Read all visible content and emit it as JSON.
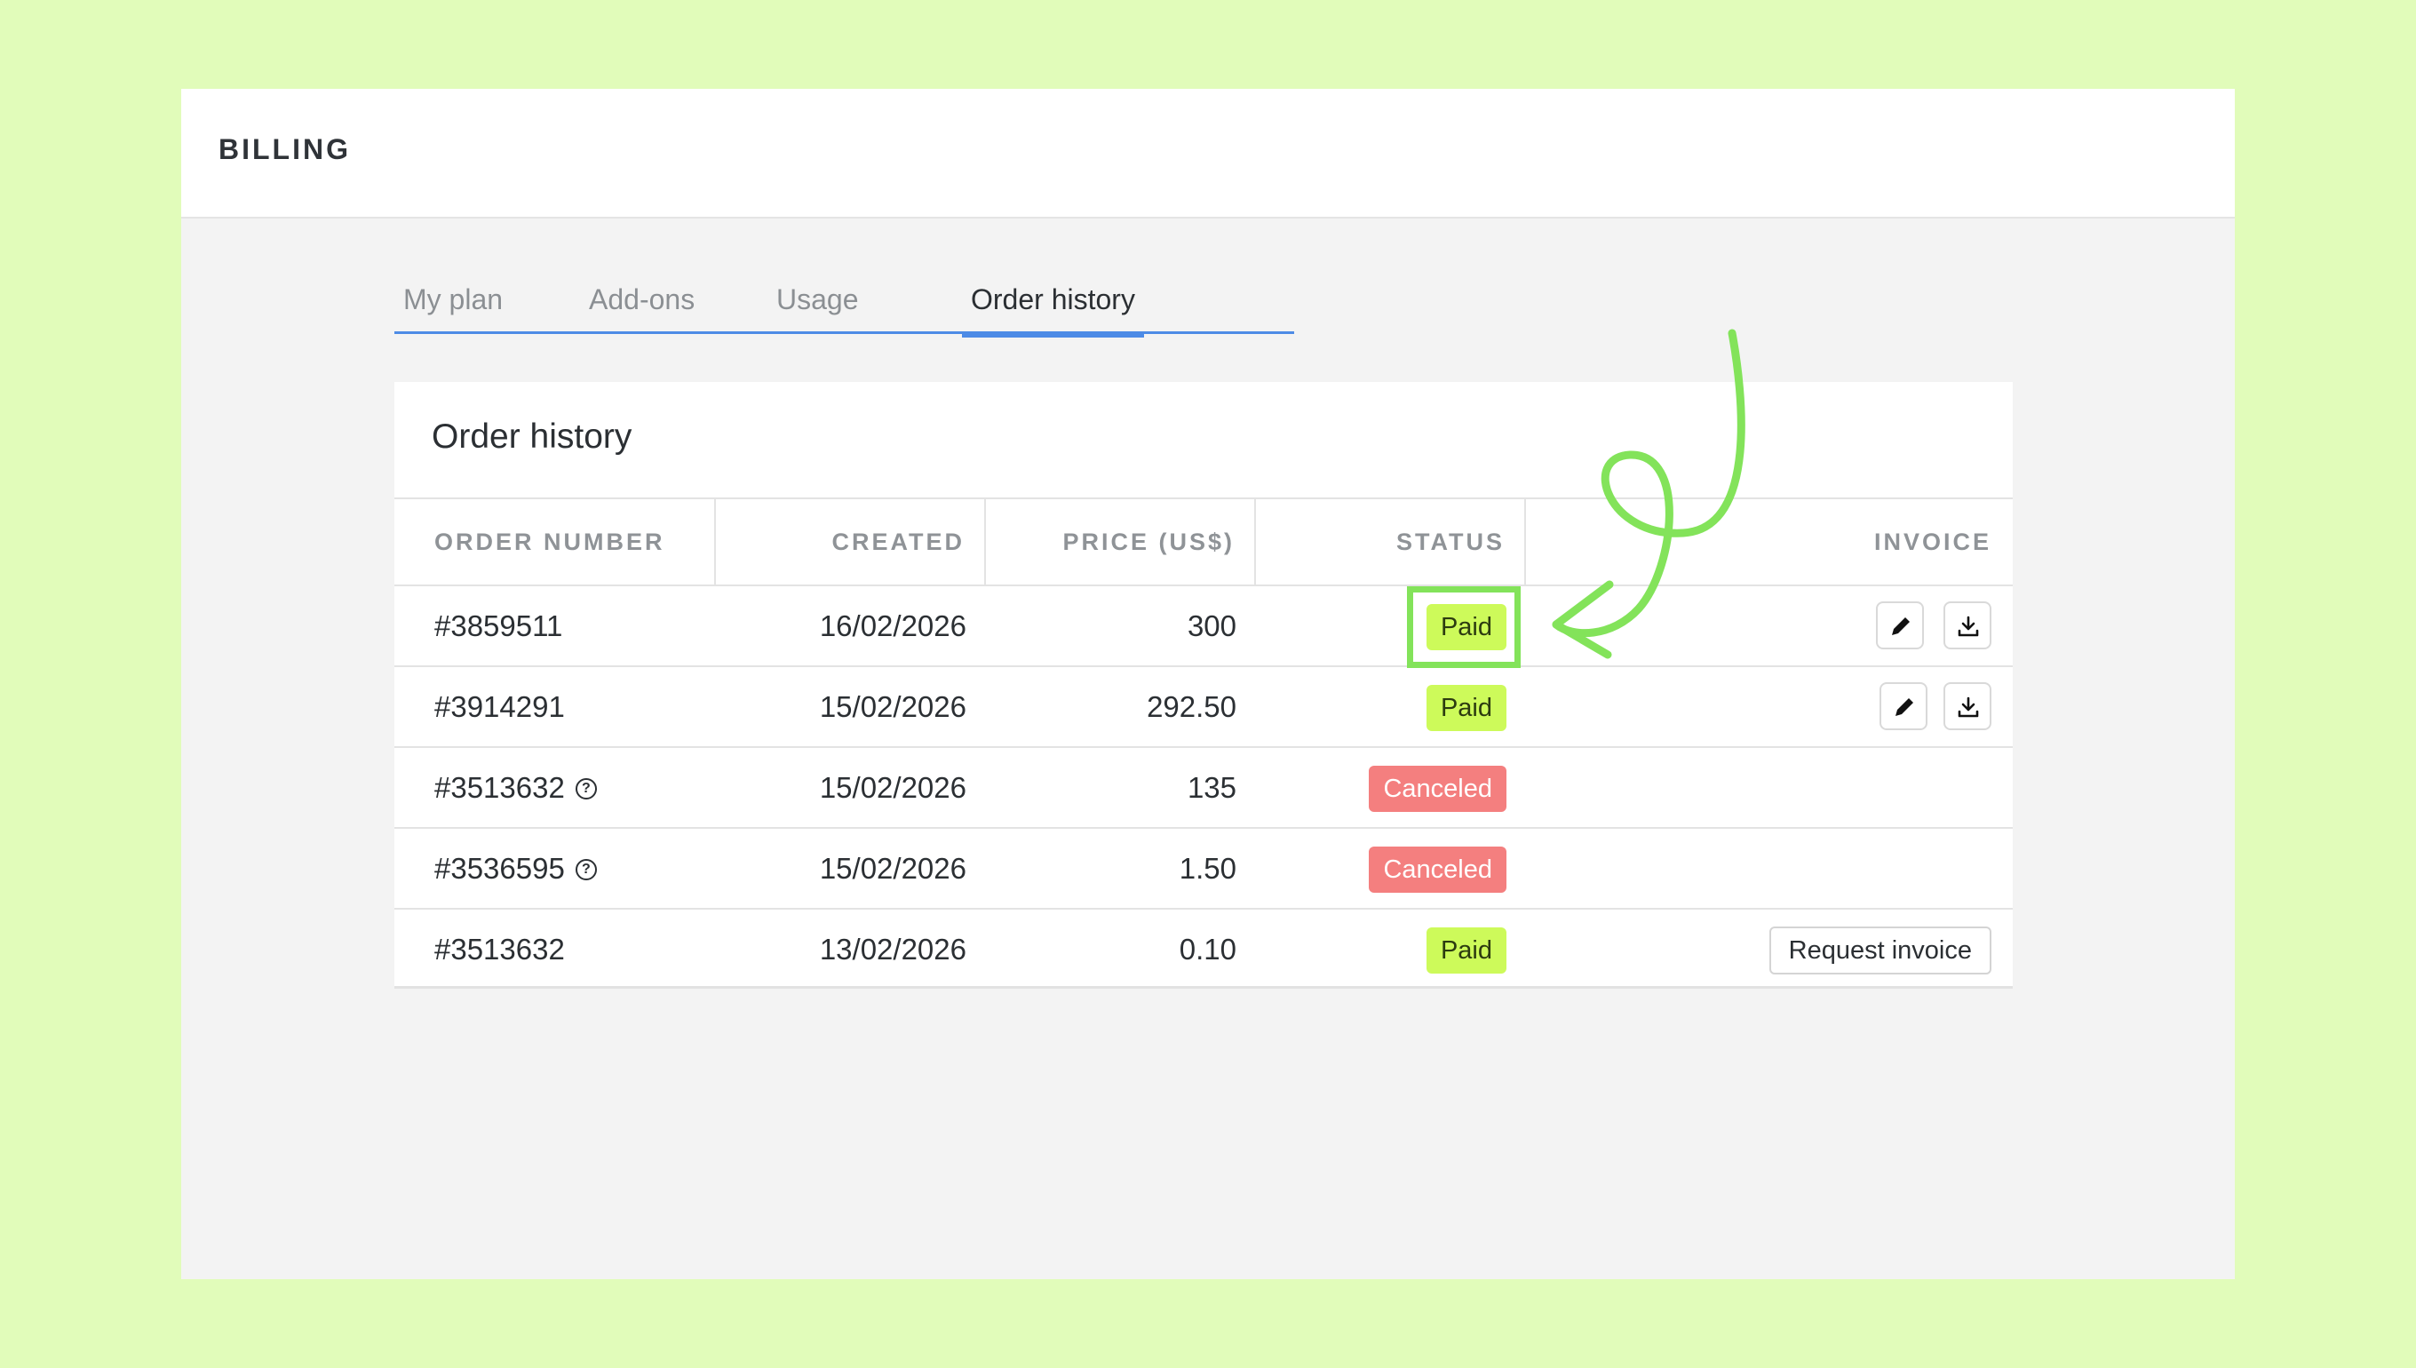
{
  "header": {
    "title": "BILLING"
  },
  "tabs": [
    {
      "label": "My plan",
      "active": false
    },
    {
      "label": "Add-ons",
      "active": false
    },
    {
      "label": "Usage",
      "active": false
    },
    {
      "label": "Order history",
      "active": true
    }
  ],
  "order_history": {
    "title": "Order history",
    "columns": {
      "order_number": "ORDER NUMBER",
      "created": "CREATED",
      "price": "PRICE (US$)",
      "status": "STATUS",
      "invoice": "INVOICE"
    },
    "rows": [
      {
        "order_number": "#3859511",
        "help_icon": false,
        "created": "16/02/2026",
        "price": "300",
        "status": "Paid",
        "invoice": "icons"
      },
      {
        "order_number": "#3914291",
        "help_icon": false,
        "created": "15/02/2026",
        "price": "292.50",
        "status": "Paid",
        "invoice": "icons"
      },
      {
        "order_number": "#3513632",
        "help_icon": true,
        "created": "15/02/2026",
        "price": "135",
        "status": "Canceled",
        "invoice": "none"
      },
      {
        "order_number": "#3536595",
        "help_icon": true,
        "created": "15/02/2026",
        "price": "1.50",
        "status": "Canceled",
        "invoice": "none"
      },
      {
        "order_number": "#3513632",
        "help_icon": false,
        "created": "13/02/2026",
        "price": "0.10",
        "status": "Paid",
        "invoice": "Request invoice"
      }
    ]
  },
  "icons": {
    "help": "question-circle-icon",
    "edit": "pencil-icon",
    "download": "download-icon"
  },
  "colors": {
    "background": "#e1fcba",
    "accent": "#4d8be6",
    "paid": "#cdfa5a",
    "canceled": "#f47f7f",
    "annotation": "#83e35a"
  }
}
